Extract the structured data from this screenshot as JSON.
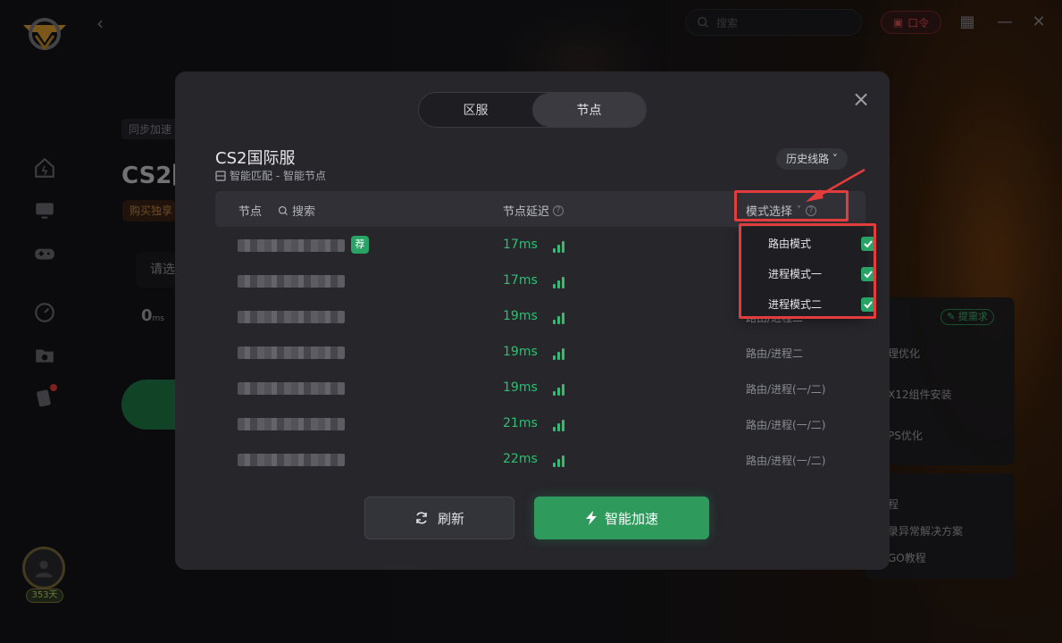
{
  "topbar": {
    "search_placeholder": "搜索",
    "kouling_label": "口令"
  },
  "sidebar": {
    "avatar_days": "353天"
  },
  "background_page": {
    "sync_tag": "同步加速",
    "game_title_partial": "CS2国",
    "buy_tag_partial": "购买独享",
    "select_partial": "请选",
    "latency_value": "0",
    "latency_unit": "ms",
    "right_panel": {
      "need_tag": "提需求",
      "items": [
        "理优化",
        "X12组件安装",
        "PS优化"
      ],
      "items2": [
        "程",
        "录异常解决方案",
        "GO教程"
      ]
    }
  },
  "modal": {
    "tabs": [
      {
        "label": "区服",
        "active": false
      },
      {
        "label": "节点",
        "active": true
      }
    ],
    "title": "CS2国际服",
    "subtitle": "智能匹配 - 智能节点",
    "history_button": "历史线路",
    "table_header": {
      "node": "节点",
      "search": "搜索",
      "latency": "节点延迟",
      "mode": "模式选择"
    },
    "rows": [
      {
        "latency": "17ms",
        "mode": "",
        "recommended": true
      },
      {
        "latency": "17ms",
        "mode": "",
        "recommended": false
      },
      {
        "latency": "19ms",
        "mode": "路由/进程二",
        "recommended": false
      },
      {
        "latency": "19ms",
        "mode": "路由/进程二",
        "recommended": false
      },
      {
        "latency": "19ms",
        "mode": "路由/进程(一/二)",
        "recommended": false
      },
      {
        "latency": "21ms",
        "mode": "路由/进程(一/二)",
        "recommended": false
      },
      {
        "latency": "22ms",
        "mode": "路由/进程(一/二)",
        "recommended": false
      }
    ],
    "recommend_badge": "荐",
    "mode_dropdown": [
      {
        "label": "路由模式",
        "checked": true
      },
      {
        "label": "进程模式一",
        "checked": true
      },
      {
        "label": "进程模式二",
        "checked": true
      }
    ],
    "refresh_button": "刷新",
    "accelerate_button": "智能加速"
  },
  "colors": {
    "accent_green": "#2e9a5c",
    "latency_green": "#2fbf73",
    "annotation_red": "#e23c3c"
  }
}
